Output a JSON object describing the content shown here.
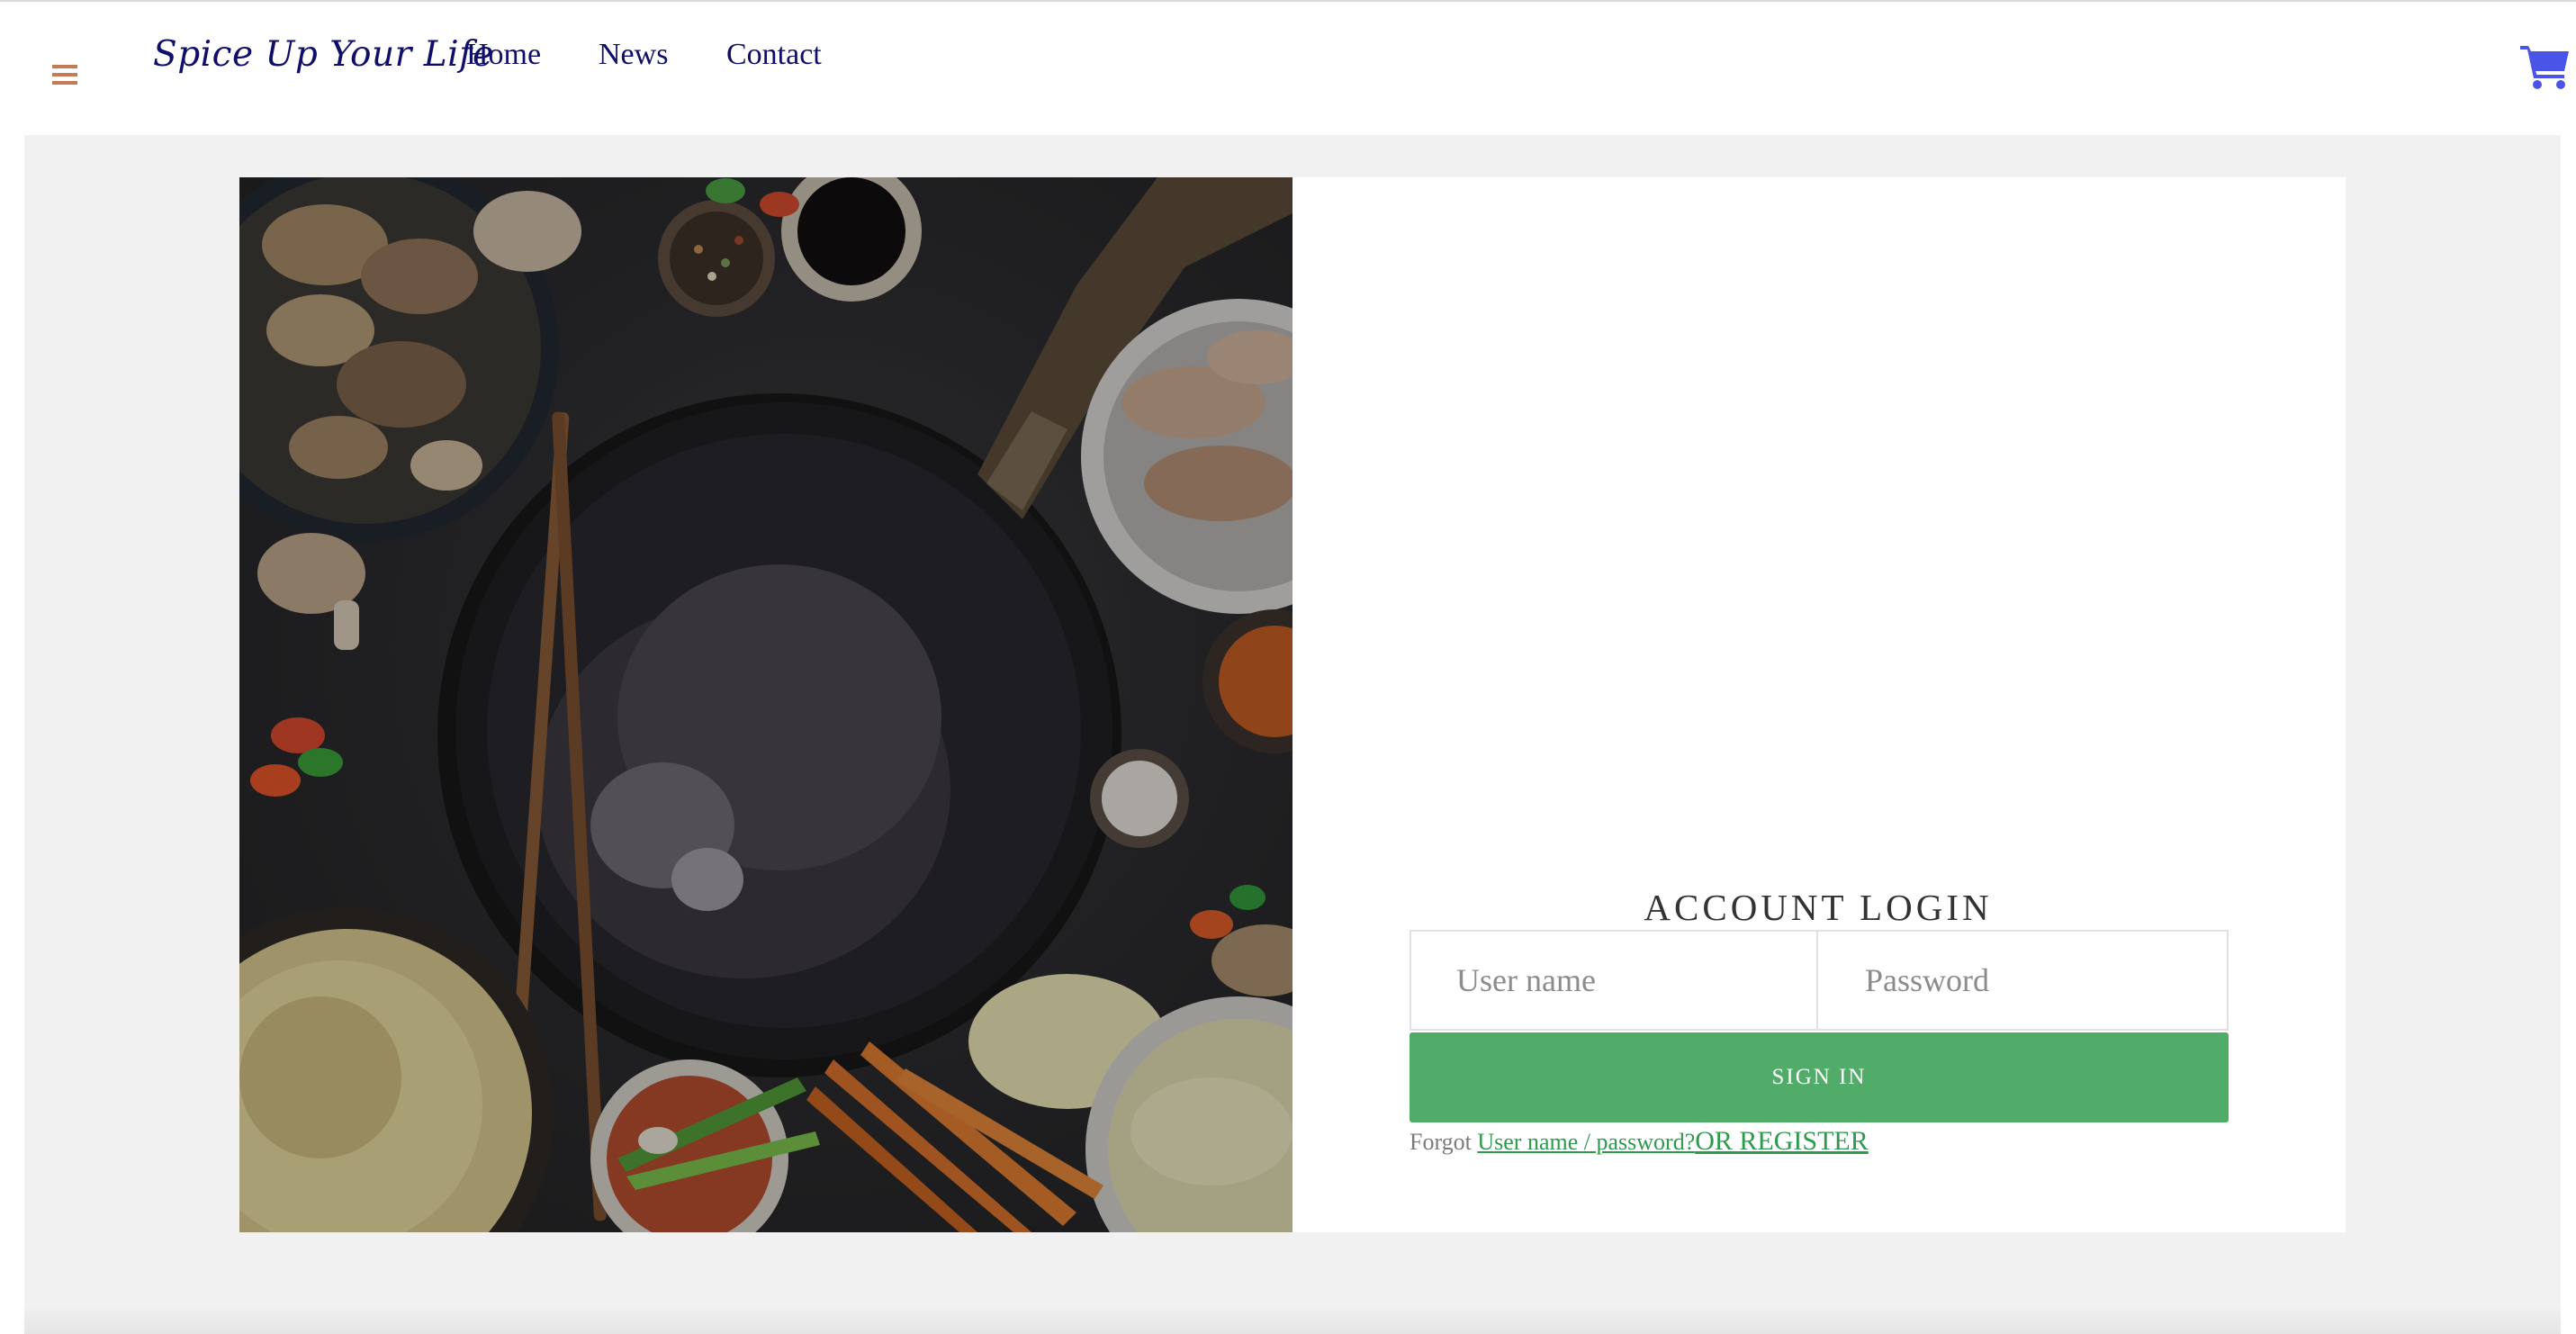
{
  "nav": {
    "menu_icon": "hamburger-menu-icon",
    "brand": "Spice Up Your Life",
    "links": [
      {
        "label": "Home"
      },
      {
        "label": "News"
      },
      {
        "label": "Contact"
      }
    ],
    "cart_icon": "shopping-cart-icon"
  },
  "hero_image": {
    "subject": "food-flatlay-photo"
  },
  "login": {
    "title": "ACCOUNT LOGIN",
    "username_placeholder": "User name",
    "username_value": "",
    "password_placeholder": "Password",
    "password_value": "",
    "signin_label": "SIGN IN",
    "forgot_prefix": "Forgot",
    "forgot_link": "User name / password?",
    "register_link": "OR REGISTER"
  },
  "colors": {
    "nav_text": "#0f0f6b",
    "menu_icon": "#c27b54",
    "cart_icon": "#4a55e8",
    "button": "#51ab69",
    "link": "#2e9a4d",
    "page_bg": "#f1f1f1"
  }
}
